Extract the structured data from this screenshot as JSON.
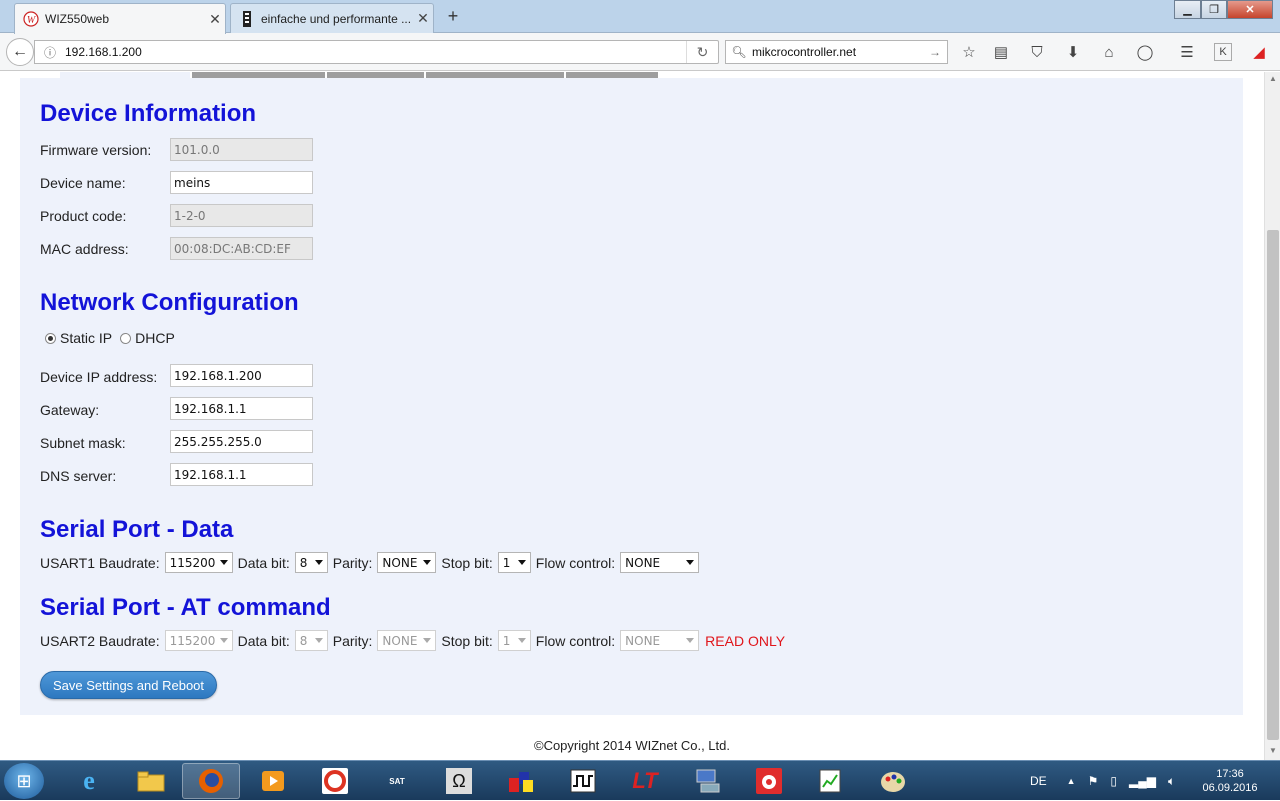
{
  "browser": {
    "tabs": [
      {
        "title": "WIZ550web",
        "icon": "wiznet-logo-icon",
        "active": true
      },
      {
        "title": "einfache und performante ...",
        "icon": "site-favicon-icon",
        "active": false
      }
    ],
    "new_tab": "+",
    "url": "192.168.1.200",
    "search_text": "mikcrocontroller.net"
  },
  "page": {
    "device_info": {
      "heading": "Device Information",
      "fields": [
        {
          "label": "Firmware version:",
          "value": "101.0.0",
          "readonly": true
        },
        {
          "label": "Device name:",
          "value": "meins",
          "readonly": false
        },
        {
          "label": "Product code:",
          "value": "1-2-0",
          "readonly": true
        },
        {
          "label": "MAC address:",
          "value": "00:08:DC:AB:CD:EF",
          "readonly": true
        }
      ]
    },
    "network": {
      "heading": "Network Configuration",
      "radio_static": "Static IP",
      "radio_dhcp": "DHCP",
      "selected": "Static IP",
      "fields": [
        {
          "label": "Device IP address:",
          "value": "192.168.1.200"
        },
        {
          "label": "Gateway:",
          "value": "192.168.1.1"
        },
        {
          "label": "Subnet mask:",
          "value": "255.255.255.0"
        },
        {
          "label": "DNS server:",
          "value": "192.168.1.1"
        }
      ]
    },
    "serial_data": {
      "heading": "Serial Port - Data",
      "baud_label": "USART1 Baudrate:",
      "baud": "115200",
      "databit_label": "Data bit:",
      "databit": "8",
      "parity_label": "Parity:",
      "parity": "NONE",
      "stopbit_label": "Stop bit:",
      "stopbit": "1",
      "flow_label": "Flow control:",
      "flow": "NONE"
    },
    "serial_at": {
      "heading": "Serial Port - AT command",
      "baud_label": "USART2 Baudrate:",
      "baud": "115200",
      "databit_label": "Data bit:",
      "databit": "8",
      "parity_label": "Parity:",
      "parity": "NONE",
      "stopbit_label": "Stop bit:",
      "stopbit": "1",
      "flow_label": "Flow control:",
      "flow": "NONE",
      "readonly_note": "READ ONLY"
    },
    "save_button": "Save Settings and Reboot",
    "copyright": "©Copyright 2014 WIZnet Co., Ltd."
  },
  "taskbar": {
    "language": "DE",
    "time": "17:36",
    "date": "06.09.2016"
  },
  "colors": {
    "heading": "#1313d8",
    "panel_bg": "#eef2fb",
    "readonly_note": "#e0161b",
    "save_button": "#2d78c0"
  }
}
